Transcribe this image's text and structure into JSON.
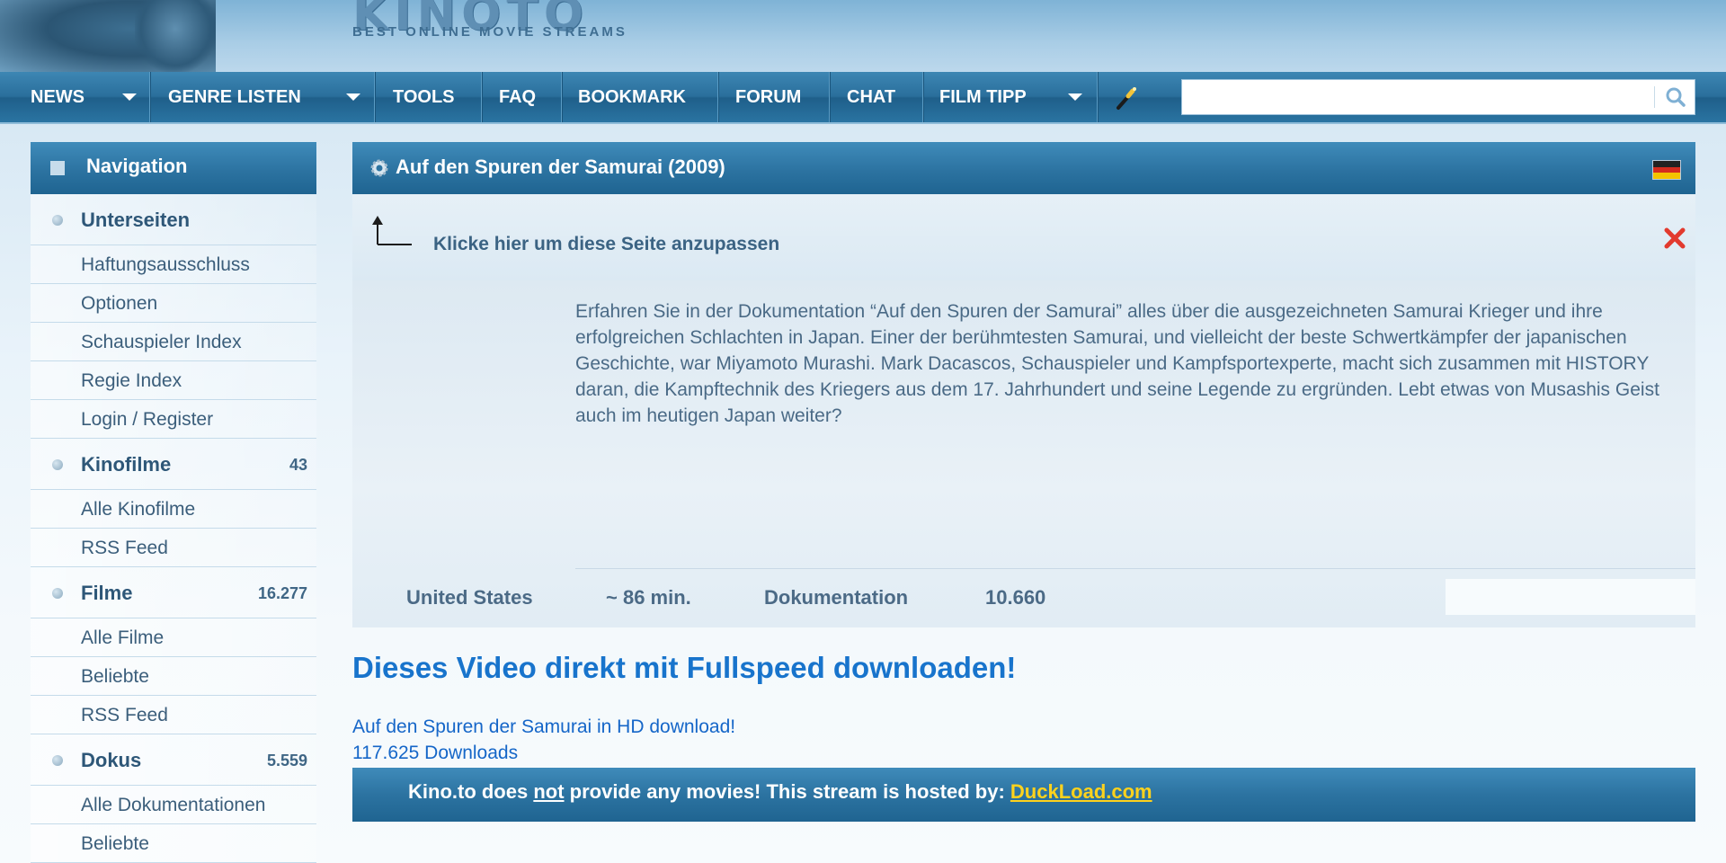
{
  "header": {
    "logo_text": "KINOTO",
    "logo_subtitle": "BEST ONLINE MOVIE STREAMS"
  },
  "navbar": {
    "items": [
      {
        "label": "NEWS"
      },
      {
        "label": "GENRE LISTEN"
      },
      {
        "label": "TOOLS"
      },
      {
        "label": "FAQ"
      },
      {
        "label": "BOOKMARK"
      },
      {
        "label": "FORUM"
      },
      {
        "label": "CHAT"
      },
      {
        "label": "FILM TIPP"
      }
    ],
    "search": {
      "placeholder": "",
      "value": ""
    }
  },
  "sidebar": {
    "title": "Navigation",
    "sections": [
      {
        "label": "Unterseiten",
        "count": "",
        "links": [
          "Haftungsausschluss",
          "Optionen",
          "Schauspieler Index",
          "Regie Index",
          "Login / Register"
        ]
      },
      {
        "label": "Kinofilme",
        "count": "43",
        "links": [
          "Alle Kinofilme",
          "RSS Feed"
        ]
      },
      {
        "label": "Filme",
        "count": "16.277",
        "links": [
          "Alle Filme",
          "Beliebte",
          "RSS Feed"
        ]
      },
      {
        "label": "Dokus",
        "count": "5.559",
        "links": [
          "Alle Dokumentationen",
          "Beliebte"
        ]
      }
    ]
  },
  "main": {
    "title": "Auf den Spuren der Samurai (2009)",
    "adjust_text": "Klicke hier um diese Seite anzupassen",
    "description": "Erfahren Sie in der Dokumentation “Auf den Spuren der Samurai” alles über die ausgezeichneten Samurai Krieger und ihre erfolgreichen Schlachten in Japan. Einer der berühmtesten Samurai, und vielleicht der beste Schwertkämpfer der japanischen Geschichte, war Miyamoto Murashi. Mark Dacascos, Schauspieler und Kampfsportexperte, macht sich zusammen mit HISTORY daran, die Kampftechnik des Kriegers aus dem 17. Jahrhundert und seine Legende zu ergründen. Lebt etwas von Musashis Geist auch im heutigen Japan weiter?",
    "meta": {
      "country": "United States",
      "duration": "~ 86 min.",
      "genre": "Dokumentation",
      "views": "10.660"
    },
    "download_title": "Dieses Video direkt mit Fullspeed downloaden!",
    "download_link": "Auf den Spuren der Samurai in HD download!",
    "download_count": "117.625 Downloads",
    "host": {
      "prefix": "Kino.to does ",
      "emph": "not",
      "suffix": " provide any movies! This stream is hosted by: ",
      "link": "DuckLoad.com"
    }
  },
  "colors": {
    "accent_blue": "#2c73a1",
    "link_blue": "#1566c8",
    "host_link_yellow": "#ffd21c",
    "close_red": "#e23a2e"
  }
}
